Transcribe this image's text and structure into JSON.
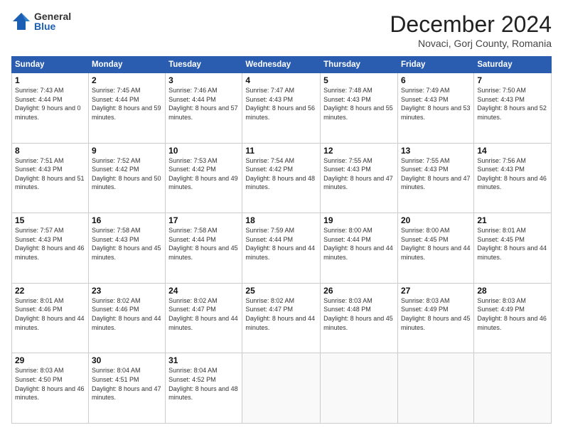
{
  "logo": {
    "general": "General",
    "blue": "Blue"
  },
  "header": {
    "month": "December 2024",
    "location": "Novaci, Gorj County, Romania"
  },
  "weekdays": [
    "Sunday",
    "Monday",
    "Tuesday",
    "Wednesday",
    "Thursday",
    "Friday",
    "Saturday"
  ],
  "weeks": [
    [
      {
        "day": "1",
        "sunrise": "7:43 AM",
        "sunset": "4:44 PM",
        "daylight": "9 hours and 0 minutes."
      },
      {
        "day": "2",
        "sunrise": "7:45 AM",
        "sunset": "4:44 PM",
        "daylight": "8 hours and 59 minutes."
      },
      {
        "day": "3",
        "sunrise": "7:46 AM",
        "sunset": "4:44 PM",
        "daylight": "8 hours and 57 minutes."
      },
      {
        "day": "4",
        "sunrise": "7:47 AM",
        "sunset": "4:43 PM",
        "daylight": "8 hours and 56 minutes."
      },
      {
        "day": "5",
        "sunrise": "7:48 AM",
        "sunset": "4:43 PM",
        "daylight": "8 hours and 55 minutes."
      },
      {
        "day": "6",
        "sunrise": "7:49 AM",
        "sunset": "4:43 PM",
        "daylight": "8 hours and 53 minutes."
      },
      {
        "day": "7",
        "sunrise": "7:50 AM",
        "sunset": "4:43 PM",
        "daylight": "8 hours and 52 minutes."
      }
    ],
    [
      {
        "day": "8",
        "sunrise": "7:51 AM",
        "sunset": "4:43 PM",
        "daylight": "8 hours and 51 minutes."
      },
      {
        "day": "9",
        "sunrise": "7:52 AM",
        "sunset": "4:42 PM",
        "daylight": "8 hours and 50 minutes."
      },
      {
        "day": "10",
        "sunrise": "7:53 AM",
        "sunset": "4:42 PM",
        "daylight": "8 hours and 49 minutes."
      },
      {
        "day": "11",
        "sunrise": "7:54 AM",
        "sunset": "4:42 PM",
        "daylight": "8 hours and 48 minutes."
      },
      {
        "day": "12",
        "sunrise": "7:55 AM",
        "sunset": "4:43 PM",
        "daylight": "8 hours and 47 minutes."
      },
      {
        "day": "13",
        "sunrise": "7:55 AM",
        "sunset": "4:43 PM",
        "daylight": "8 hours and 47 minutes."
      },
      {
        "day": "14",
        "sunrise": "7:56 AM",
        "sunset": "4:43 PM",
        "daylight": "8 hours and 46 minutes."
      }
    ],
    [
      {
        "day": "15",
        "sunrise": "7:57 AM",
        "sunset": "4:43 PM",
        "daylight": "8 hours and 46 minutes."
      },
      {
        "day": "16",
        "sunrise": "7:58 AM",
        "sunset": "4:43 PM",
        "daylight": "8 hours and 45 minutes."
      },
      {
        "day": "17",
        "sunrise": "7:58 AM",
        "sunset": "4:44 PM",
        "daylight": "8 hours and 45 minutes."
      },
      {
        "day": "18",
        "sunrise": "7:59 AM",
        "sunset": "4:44 PM",
        "daylight": "8 hours and 44 minutes."
      },
      {
        "day": "19",
        "sunrise": "8:00 AM",
        "sunset": "4:44 PM",
        "daylight": "8 hours and 44 minutes."
      },
      {
        "day": "20",
        "sunrise": "8:00 AM",
        "sunset": "4:45 PM",
        "daylight": "8 hours and 44 minutes."
      },
      {
        "day": "21",
        "sunrise": "8:01 AM",
        "sunset": "4:45 PM",
        "daylight": "8 hours and 44 minutes."
      }
    ],
    [
      {
        "day": "22",
        "sunrise": "8:01 AM",
        "sunset": "4:46 PM",
        "daylight": "8 hours and 44 minutes."
      },
      {
        "day": "23",
        "sunrise": "8:02 AM",
        "sunset": "4:46 PM",
        "daylight": "8 hours and 44 minutes."
      },
      {
        "day": "24",
        "sunrise": "8:02 AM",
        "sunset": "4:47 PM",
        "daylight": "8 hours and 44 minutes."
      },
      {
        "day": "25",
        "sunrise": "8:02 AM",
        "sunset": "4:47 PM",
        "daylight": "8 hours and 44 minutes."
      },
      {
        "day": "26",
        "sunrise": "8:03 AM",
        "sunset": "4:48 PM",
        "daylight": "8 hours and 45 minutes."
      },
      {
        "day": "27",
        "sunrise": "8:03 AM",
        "sunset": "4:49 PM",
        "daylight": "8 hours and 45 minutes."
      },
      {
        "day": "28",
        "sunrise": "8:03 AM",
        "sunset": "4:49 PM",
        "daylight": "8 hours and 46 minutes."
      }
    ],
    [
      {
        "day": "29",
        "sunrise": "8:03 AM",
        "sunset": "4:50 PM",
        "daylight": "8 hours and 46 minutes."
      },
      {
        "day": "30",
        "sunrise": "8:04 AM",
        "sunset": "4:51 PM",
        "daylight": "8 hours and 47 minutes."
      },
      {
        "day": "31",
        "sunrise": "8:04 AM",
        "sunset": "4:52 PM",
        "daylight": "8 hours and 48 minutes."
      },
      null,
      null,
      null,
      null
    ]
  ]
}
